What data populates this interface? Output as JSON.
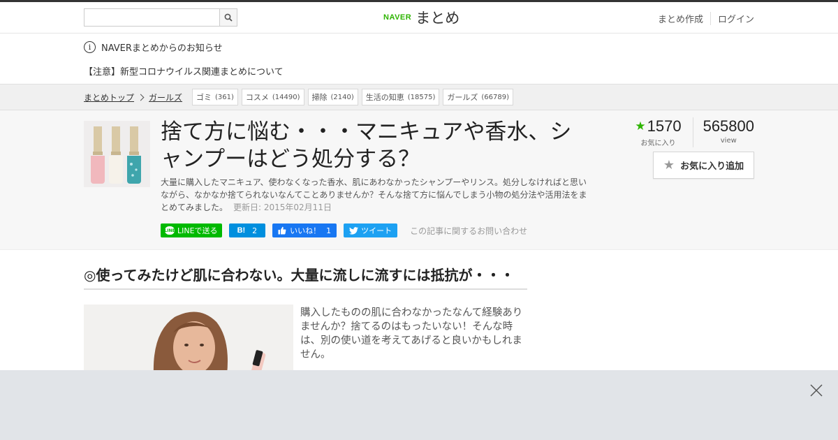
{
  "header": {
    "search_placeholder": "",
    "logo_naver": "NAVER",
    "logo_matome": "まとめ",
    "create_label": "まとめ作成",
    "login_label": "ログイン"
  },
  "notice": {
    "title": "NAVERまとめからのお知らせ",
    "item": "【注意】新型コロナウイルス関連まとめについて"
  },
  "breadcrumb": {
    "items": [
      "まとめトップ",
      "ガールズ"
    ]
  },
  "tags": [
    {
      "name": "ゴミ",
      "count": "(361)"
    },
    {
      "name": "コスメ",
      "count": "(14490)"
    },
    {
      "name": "掃除",
      "count": "(2140)"
    },
    {
      "name": "生活の知恵",
      "count": "(18575)"
    },
    {
      "name": "ガールズ",
      "count": "(66789)"
    }
  ],
  "article": {
    "title": "捨て方に悩む・・・マニキュアや香水、シャンプーはどう処分する？",
    "description": "大量に購入したマニキュア、使わなくなった香水、肌にあわなかったシャンプーやリンス。処分しなければと思いながら、なかなか捨てられないなんてことありませんか？そんな捨て方に悩んでしまう小物の処分法や活用法をまとめてみました。",
    "updated": "更新日: 2015年02月11日",
    "favorites": "1570",
    "favorites_label": "お気に入り",
    "views": "565800",
    "views_label": "view",
    "fav_button": "お気に入り追加"
  },
  "share": {
    "line": "LINEで送る",
    "line_icon": "LINE",
    "hatena_icon": "B!",
    "hatena_count": "2",
    "fb_label": "いいね！",
    "fb_count": "1",
    "tweet": "ツイート",
    "inquiry": "この記事に関するお問い合わせ"
  },
  "section": {
    "heading": "◎使ってみたけど肌に合わない。大量に流しに流すには抵抗が・・・",
    "body": "購入したものの肌に合わなかったなんて経験ありませんか？捨てるのはもったいない！そんな時は、別の使い道を考えてあげると良いかもしれません。"
  },
  "colors": {
    "naver_green": "#2db400",
    "line_green": "#00b900",
    "hatena_blue": "#008fde",
    "facebook_blue": "#1877f2",
    "twitter_blue": "#1da1f2",
    "ad_bg": "#e1e4e8"
  }
}
